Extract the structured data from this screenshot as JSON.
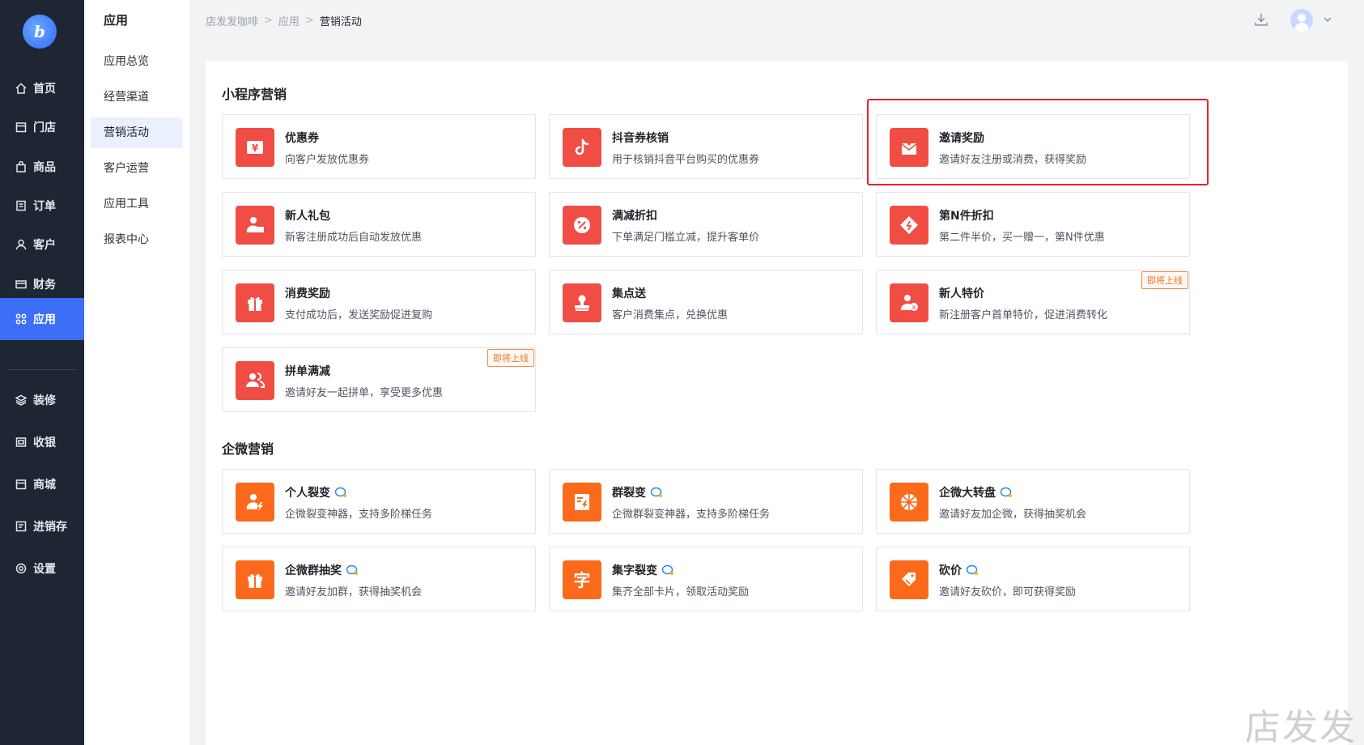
{
  "app": {
    "logo_text": "b"
  },
  "main_nav": [
    {
      "label": "首页",
      "icon": "home-icon"
    },
    {
      "label": "门店",
      "icon": "store-icon"
    },
    {
      "label": "商品",
      "icon": "bag-icon"
    },
    {
      "label": "订单",
      "icon": "order-icon"
    },
    {
      "label": "客户",
      "icon": "user-icon"
    },
    {
      "label": "财务",
      "icon": "wallet-icon"
    },
    {
      "label": "应用",
      "icon": "apps-icon",
      "active": true
    },
    {
      "label": "装修",
      "icon": "layers-icon"
    },
    {
      "label": "收银",
      "icon": "cashier-icon"
    },
    {
      "label": "商城",
      "icon": "mall-icon"
    },
    {
      "label": "进销存",
      "icon": "inventory-icon"
    },
    {
      "label": "设置",
      "icon": "settings-icon"
    }
  ],
  "sub_nav": {
    "title": "应用",
    "items": [
      "应用总览",
      "经营渠道",
      "营销活动",
      "客户运营",
      "应用工具",
      "报表中心"
    ],
    "active": "营销活动"
  },
  "breadcrumb": [
    "店发发咖啡",
    "应用",
    "营销活动"
  ],
  "header": {
    "download_icon": "download-icon",
    "avatar_icon": "avatar",
    "chevron": "chevron-down-icon"
  },
  "sections": [
    {
      "title": "小程序营销",
      "cards": [
        {
          "title": "优惠券",
          "desc": "向客户发放优惠券",
          "icon": "coupon-icon",
          "color": "#f04d45"
        },
        {
          "title": "抖音券核销",
          "desc": "用于核销抖音平台购买的优惠券",
          "icon": "tiktok-icon",
          "color": "#f04d45"
        },
        {
          "title": "邀请奖励",
          "desc": "邀请好友注册或消费，获得奖励",
          "icon": "invite-envelope-icon",
          "color": "#f04d45",
          "highlighted": true
        },
        {
          "title": "新人礼包",
          "desc": "新客注册成功后自动发放优惠",
          "icon": "new-user-gift-icon",
          "color": "#f04d45"
        },
        {
          "title": "满减折扣",
          "desc": "下单满足门槛立减，提升客单价",
          "icon": "percent-icon",
          "color": "#f04d45"
        },
        {
          "title": "第N件折扣",
          "desc": "第二件半价，买一赠一，第N件优惠",
          "icon": "tag-icon",
          "color": "#f04d45"
        },
        {
          "title": "消费奖励",
          "desc": "支付成功后，发送奖励促进复购",
          "icon": "gift-icon",
          "color": "#f04d45"
        },
        {
          "title": "集点送",
          "desc": "客户消费集点，兑换优惠",
          "icon": "stamp-icon",
          "color": "#f04d45"
        },
        {
          "title": "新人特价",
          "desc": "新注册客户首单特价，促进消费转化",
          "icon": "new-user-price-icon",
          "color": "#f04d45",
          "badge": "即将上线"
        },
        {
          "title": "拼单满减",
          "desc": "邀请好友一起拼单，享受更多优惠",
          "icon": "group-users-icon",
          "color": "#f04d45",
          "badge": "即将上线"
        }
      ]
    },
    {
      "title": "企微营销",
      "cards": [
        {
          "title": "个人裂变",
          "desc": "企微裂变神器，支持多阶梯任务",
          "icon": "user-fission-icon",
          "color": "#fb6a1b"
        },
        {
          "title": "群裂变",
          "desc": "企微群裂变神器，支持多阶梯任务",
          "icon": "group-fission-icon",
          "color": "#fb6a1b"
        },
        {
          "title": "企微大转盘",
          "desc": "邀请好友加企微，获得抽奖机会",
          "icon": "wheel-icon",
          "color": "#fb6a1b"
        },
        {
          "title": "企微群抽奖",
          "desc": "邀请好友加群，获得抽奖机会",
          "icon": "gift-box-icon",
          "color": "#fb6a1b"
        },
        {
          "title": "集字裂变",
          "desc": "集齐全部卡片，领取活动奖励",
          "icon": "character-icon",
          "color": "#fb6a1b",
          "glyph": "字"
        },
        {
          "title": "砍价",
          "desc": "邀请好友砍价，即可获得奖励",
          "icon": "bargain-tag-icon",
          "color": "#fb6a1b"
        }
      ]
    }
  ],
  "watermark": "店发发"
}
